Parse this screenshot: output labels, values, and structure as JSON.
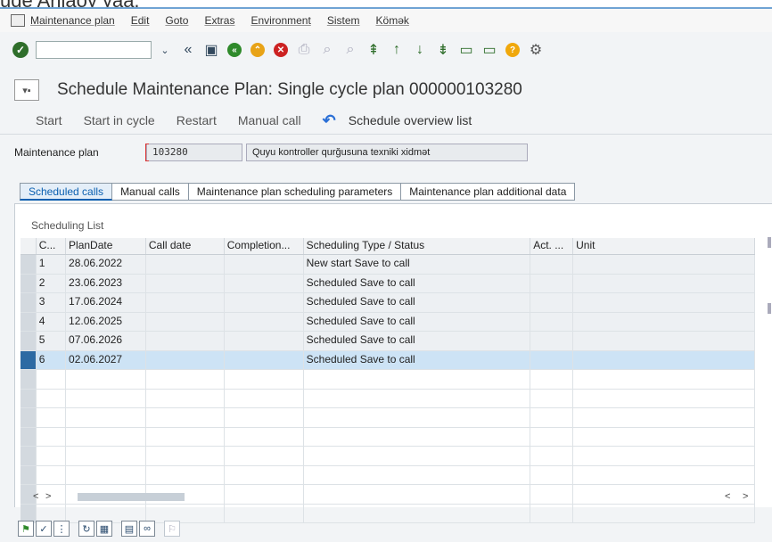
{
  "top_strip": {
    "text": "ude Ariiaoy yaa."
  },
  "menu": {
    "items": [
      "Maintenance plan",
      "Edit",
      "Goto",
      "Extras",
      "Environment",
      "Sistem",
      "Kömək"
    ]
  },
  "title": "Schedule Maintenance Plan: Single cycle plan 000000103280",
  "actions": {
    "start": "Start",
    "start_in_cycle": "Start in cycle",
    "restart": "Restart",
    "manual_call": "Manual call",
    "schedule_overview": "Schedule overview list"
  },
  "field": {
    "label": "Maintenance plan",
    "value": "103280",
    "description": "Quyu kontroller qurğusuna texniki xidmət"
  },
  "tabs": [
    "Scheduled calls",
    "Manual calls",
    "Maintenance plan scheduling parameters",
    "Maintenance plan additional data"
  ],
  "list": {
    "title": "Scheduling List",
    "columns": [
      "C...",
      "PlanDate",
      "Call date",
      "Completion...",
      "Scheduling Type / Status",
      "Act. ...",
      "Unit"
    ],
    "rows": [
      [
        "1",
        "28.06.2022",
        "",
        "",
        "New start  Save to call",
        "",
        ""
      ],
      [
        "2",
        "23.06.2023",
        "",
        "",
        "Scheduled  Save to call",
        "",
        ""
      ],
      [
        "3",
        "17.06.2024",
        "",
        "",
        "Scheduled  Save to call",
        "",
        ""
      ],
      [
        "4",
        "12.06.2025",
        "",
        "",
        "Scheduled  Save to call",
        "",
        ""
      ],
      [
        "5",
        "07.06.2026",
        "",
        "",
        "Scheduled  Save to call",
        "",
        ""
      ],
      [
        "6",
        "02.06.2027",
        "",
        "",
        "Scheduled  Save to call",
        "",
        ""
      ]
    ]
  },
  "colors": {
    "accent": "#0a5fb0",
    "ok": "#2f6e2b",
    "selected_row": "#cde3f5"
  }
}
